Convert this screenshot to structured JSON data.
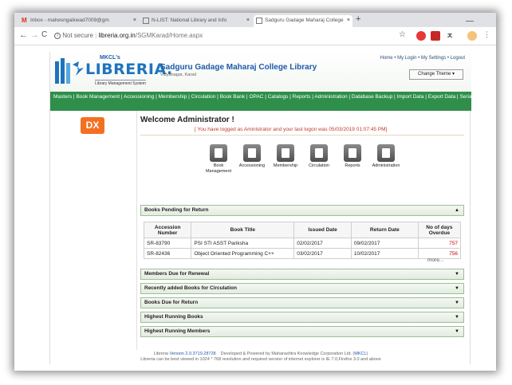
{
  "browser": {
    "tabs": [
      {
        "title": "Inbox - mahesngaikwad7009@gm",
        "close": "×"
      },
      {
        "title": "N-LIST: National Library and Info",
        "close": "×"
      },
      {
        "title": "Sadguru Gadage Maharaj College",
        "close": "×"
      }
    ],
    "new_tab": "+",
    "security_label": "Not secure",
    "url_host": "libreria.org.in",
    "url_path": "/SGMKarad/Home.aspx"
  },
  "header": {
    "logo_mkcl": "MKCL's",
    "logo_name": "LIBRERIA.",
    "logo_sub": "Library Management System",
    "college_name": "Sadguru Gadage Maharaj College Library",
    "place": "Vidyanagar, Karad",
    "top_links": "Home • My Login • My Settings • Logout",
    "change_theme": "Change Theme ▾"
  },
  "menu": {
    "items": [
      "Masters",
      "Book Management",
      "Accessioning",
      "Membership",
      "Circulation",
      "Book Bank",
      "OPAC",
      "Catalogs",
      "Reports",
      "Administration",
      "Database Backup",
      "Import Data",
      "Export Data",
      "Serials Management"
    ]
  },
  "main": {
    "welcome": "Welcome Administrator !",
    "last_logon": "[ You have logged as Aministrator and your last logon was 05/03/2019 01:07:45 PM]",
    "quick_icons": [
      {
        "label": "Book Management"
      },
      {
        "label": "Accessioning"
      },
      {
        "label": "Membership"
      },
      {
        "label": "Circulation"
      },
      {
        "label": "Reports"
      },
      {
        "label": "Administration"
      }
    ],
    "books_pending": {
      "title": "Books Pending for Return",
      "arrow": "▲",
      "columns": [
        "Accession Number",
        "Book Title",
        "Issued Date",
        "Return Date",
        "No of days Overdue"
      ],
      "rows": [
        [
          "SR-83790",
          "PSI STI ASST Pariksha",
          "02/02/2017",
          "09/02/2017",
          "757"
        ],
        [
          "SR-82436",
          "Object Oriented Programming C++",
          "03/02/2017",
          "10/02/2017",
          "756"
        ]
      ],
      "more": "more..."
    },
    "panels": [
      {
        "title": "Members Due for Renewal",
        "arrow": "▼"
      },
      {
        "title": "Recently added Books for Circulation",
        "arrow": "▼"
      },
      {
        "title": "Books Due for Return",
        "arrow": "▼"
      },
      {
        "title": "Highest Running Books",
        "arrow": "▼"
      },
      {
        "title": "Highest Running Members",
        "arrow": "▼"
      }
    ]
  },
  "footer": {
    "line1_a": "Libreria",
    "line1_b": "Version 2.0.3719.28728",
    "line1_c": "Developed & Powered by Maharashtra Knowledge Corporation Ltd. (",
    "line1_d": "MKCL",
    "line1_e": ")",
    "line2": "Libreria can be best viewed in 1024 * 768 resolution and required version of internet explorer is IE 7.0,Firefox 3.0 and above"
  },
  "colors": {
    "menubar": "#2f8f4a",
    "accent": "#1e5aa8",
    "overdue": "#cc0000",
    "dx_icon": "#f37021"
  }
}
